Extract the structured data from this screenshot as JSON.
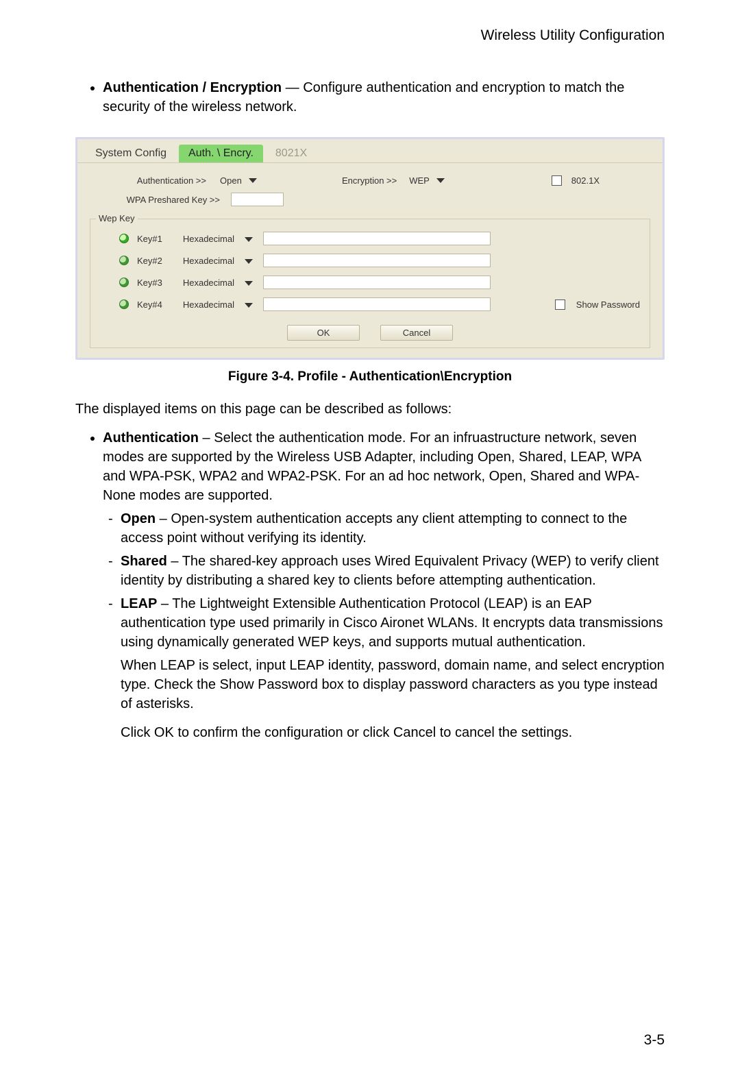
{
  "header": {
    "title": "Wireless Utility Configuration"
  },
  "intro_bullet": {
    "bold": "Authentication / Encryption",
    "rest": " — Configure authentication and encryption to match the security of the wireless network."
  },
  "screenshot": {
    "tabs": {
      "system_config": "System Config",
      "auth_encry": "Auth. \\ Encry.",
      "eap": "8021X"
    },
    "row1": {
      "auth_label": "Authentication >>",
      "auth_value": "Open",
      "enc_label": "Encryption >>",
      "enc_value": "WEP",
      "dot1x_label": "802.1X"
    },
    "row2": {
      "psk_label": "WPA Preshared Key >>"
    },
    "wep": {
      "legend": "Wep Key",
      "keys": [
        {
          "name": "Key#1",
          "fmt": "Hexadecimal",
          "selected": true
        },
        {
          "name": "Key#2",
          "fmt": "Hexadecimal",
          "selected": false
        },
        {
          "name": "Key#3",
          "fmt": "Hexadecimal",
          "selected": false
        },
        {
          "name": "Key#4",
          "fmt": "Hexadecimal",
          "selected": false
        }
      ],
      "show_pw": "Show Password"
    },
    "buttons": {
      "ok": "OK",
      "cancel": "Cancel"
    }
  },
  "figure_caption": "Figure 3-4.  Profile - Authentication\\Encryption",
  "desc_intro": "The displayed items on this page can be described as follows:",
  "auth_section": {
    "bold": "Authentication",
    "rest": " – Select the authentication mode. For an infruastructure network, seven modes are supported by the Wireless USB Adapter, including Open, Shared, LEAP, WPA and WPA-PSK, WPA2 and WPA2-PSK. For an ad hoc network, Open, Shared and WPA-None modes are supported."
  },
  "sub_open": {
    "bold": "Open",
    "rest": " – Open-system authentication accepts any client attempting to connect to the access point without verifying its identity."
  },
  "sub_shared": {
    "bold": "Shared",
    "rest": " – The shared-key approach uses Wired Equivalent Privacy (WEP) to verify client identity by distributing a shared key to clients before attempting authentication."
  },
  "sub_leap": {
    "bold": "LEAP",
    "rest": " – The Lightweight Extensible Authentication Protocol (LEAP) is an EAP authentication type used primarily in Cisco Aironet WLANs. It encrypts data transmissions using dynamically generated WEP keys, and supports mutual authentication.",
    "para2": "When LEAP is select, input LEAP identity, password, domain name, and select encryption type. Check the Show Password box to display password characters as you type instead of asterisks.",
    "para3": "Click OK to confirm the configuration or click Cancel to cancel the settings."
  },
  "page_number": "3-5"
}
